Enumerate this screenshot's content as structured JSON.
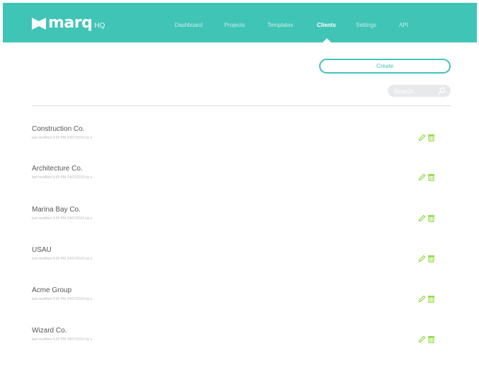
{
  "header": {
    "logo_word": "marq",
    "logo_suffix": "HQ",
    "nav": [
      {
        "label": "Dashboard",
        "active": false
      },
      {
        "label": "Projects",
        "active": false
      },
      {
        "label": "Templates",
        "active": false
      },
      {
        "label": "Clients",
        "active": true
      },
      {
        "label": "Settings",
        "active": false
      },
      {
        "label": "API",
        "active": false
      }
    ]
  },
  "toolbar": {
    "create_label": "Create",
    "search_placeholder": "Search..."
  },
  "clients": [
    {
      "name": "Construction Co.",
      "meta": "last modified 4:39 PM 24/07/2015 by o"
    },
    {
      "name": "Architecture Co.",
      "meta": "last modified 4:39 PM 24/07/2015 by o"
    },
    {
      "name": "Marina Bay Co.",
      "meta": "last modified 4:39 PM 24/07/2015 by o"
    },
    {
      "name": "USAU",
      "meta": "last modified 4:39 PM 24/07/2015 by o"
    },
    {
      "name": "Acme Group",
      "meta": "last modified 4:39 PM 24/07/2015 by o"
    },
    {
      "name": "Wizard Co.",
      "meta": "last modified 4:39 PM 24/07/2015 by o"
    }
  ],
  "colors": {
    "accent": "#40c4b6",
    "icon": "#7ed321"
  },
  "icons": {
    "logo": "marq-logo-icon",
    "search": "search-icon",
    "edit": "pencil-icon",
    "delete": "trash-icon"
  }
}
